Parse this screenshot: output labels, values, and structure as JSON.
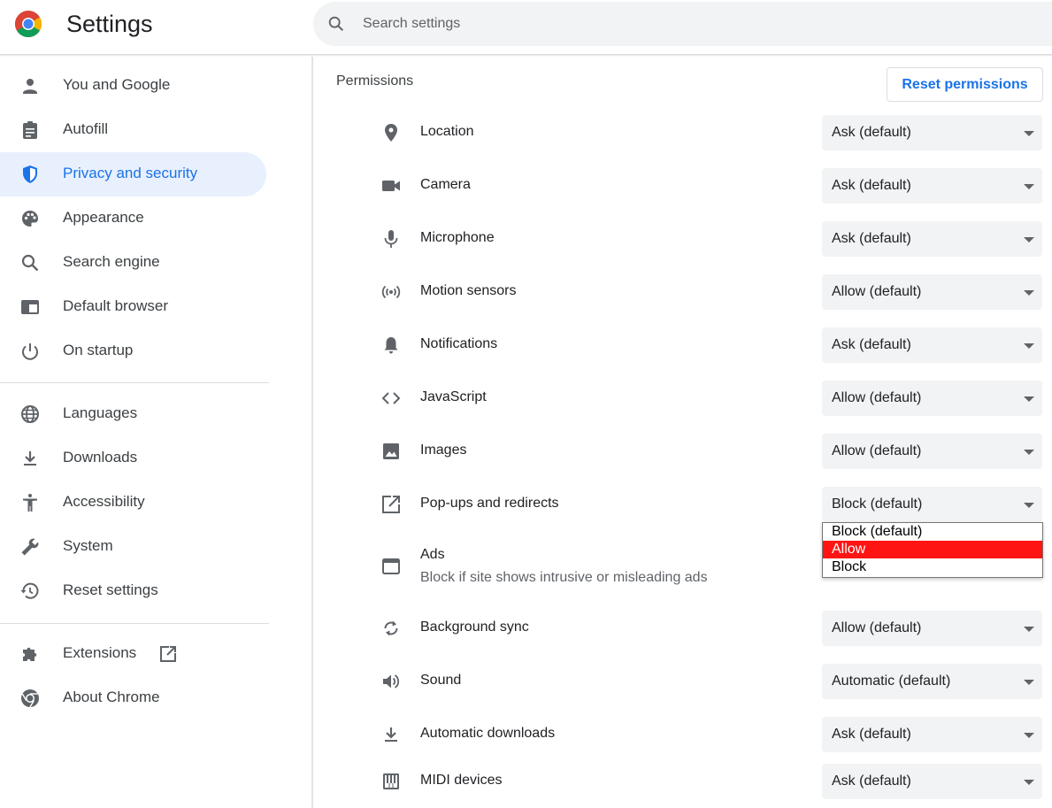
{
  "header": {
    "title": "Settings",
    "search_placeholder": "Search settings",
    "logo_icon": "chrome-logo-icon"
  },
  "sidebar": {
    "items": [
      {
        "label": "You and Google",
        "icon": "person-icon"
      },
      {
        "label": "Autofill",
        "icon": "clipboard-icon"
      },
      {
        "label": "Privacy and security",
        "icon": "shield-icon",
        "active": true
      },
      {
        "label": "Appearance",
        "icon": "palette-icon"
      },
      {
        "label": "Search engine",
        "icon": "search-icon"
      },
      {
        "label": "Default browser",
        "icon": "browser-window-icon"
      },
      {
        "label": "On startup",
        "icon": "power-icon"
      },
      {
        "label": "Languages",
        "icon": "globe-icon"
      },
      {
        "label": "Downloads",
        "icon": "download-icon"
      },
      {
        "label": "Accessibility",
        "icon": "accessibility-icon"
      },
      {
        "label": "System",
        "icon": "wrench-icon"
      },
      {
        "label": "Reset settings",
        "icon": "restore-icon"
      },
      {
        "label": "Extensions",
        "icon": "puzzle-icon"
      },
      {
        "label": "About Chrome",
        "icon": "chrome-icon"
      }
    ]
  },
  "main": {
    "section_title": "Permissions",
    "reset_button": "Reset permissions",
    "permissions": [
      {
        "label": "Location",
        "value": "Ask (default)",
        "icon": "location-pin-icon"
      },
      {
        "label": "Camera",
        "value": "Ask (default)",
        "icon": "camera-icon"
      },
      {
        "label": "Microphone",
        "value": "Ask (default)",
        "icon": "microphone-icon"
      },
      {
        "label": "Motion sensors",
        "value": "Allow (default)",
        "icon": "motion-sensors-icon"
      },
      {
        "label": "Notifications",
        "value": "Ask (default)",
        "icon": "bell-icon"
      },
      {
        "label": "JavaScript",
        "value": "Allow (default)",
        "icon": "code-icon"
      },
      {
        "label": "Images",
        "value": "Allow (default)",
        "icon": "image-icon"
      },
      {
        "label": "Pop-ups and redirects",
        "value": "Block (default)",
        "icon": "open-in-new-icon"
      },
      {
        "label": "Ads",
        "sublabel": "Block if site shows intrusive or misleading ads",
        "icon": "ads-window-icon"
      },
      {
        "label": "Background sync",
        "value": "Allow (default)",
        "icon": "sync-icon"
      },
      {
        "label": "Sound",
        "value": "Automatic (default)",
        "icon": "volume-icon"
      },
      {
        "label": "Automatic downloads",
        "value": "Ask (default)",
        "icon": "download-icon"
      },
      {
        "label": "MIDI devices",
        "value": "Ask (default)",
        "icon": "piano-icon"
      }
    ],
    "dropdown": {
      "options": [
        "Block (default)",
        "Allow",
        "Block"
      ],
      "highlighted": "Allow"
    }
  },
  "colors": {
    "accent": "#1a73e8",
    "active_nav_bg": "#e8f0fe",
    "dropdown_highlight": "#ff1414"
  }
}
